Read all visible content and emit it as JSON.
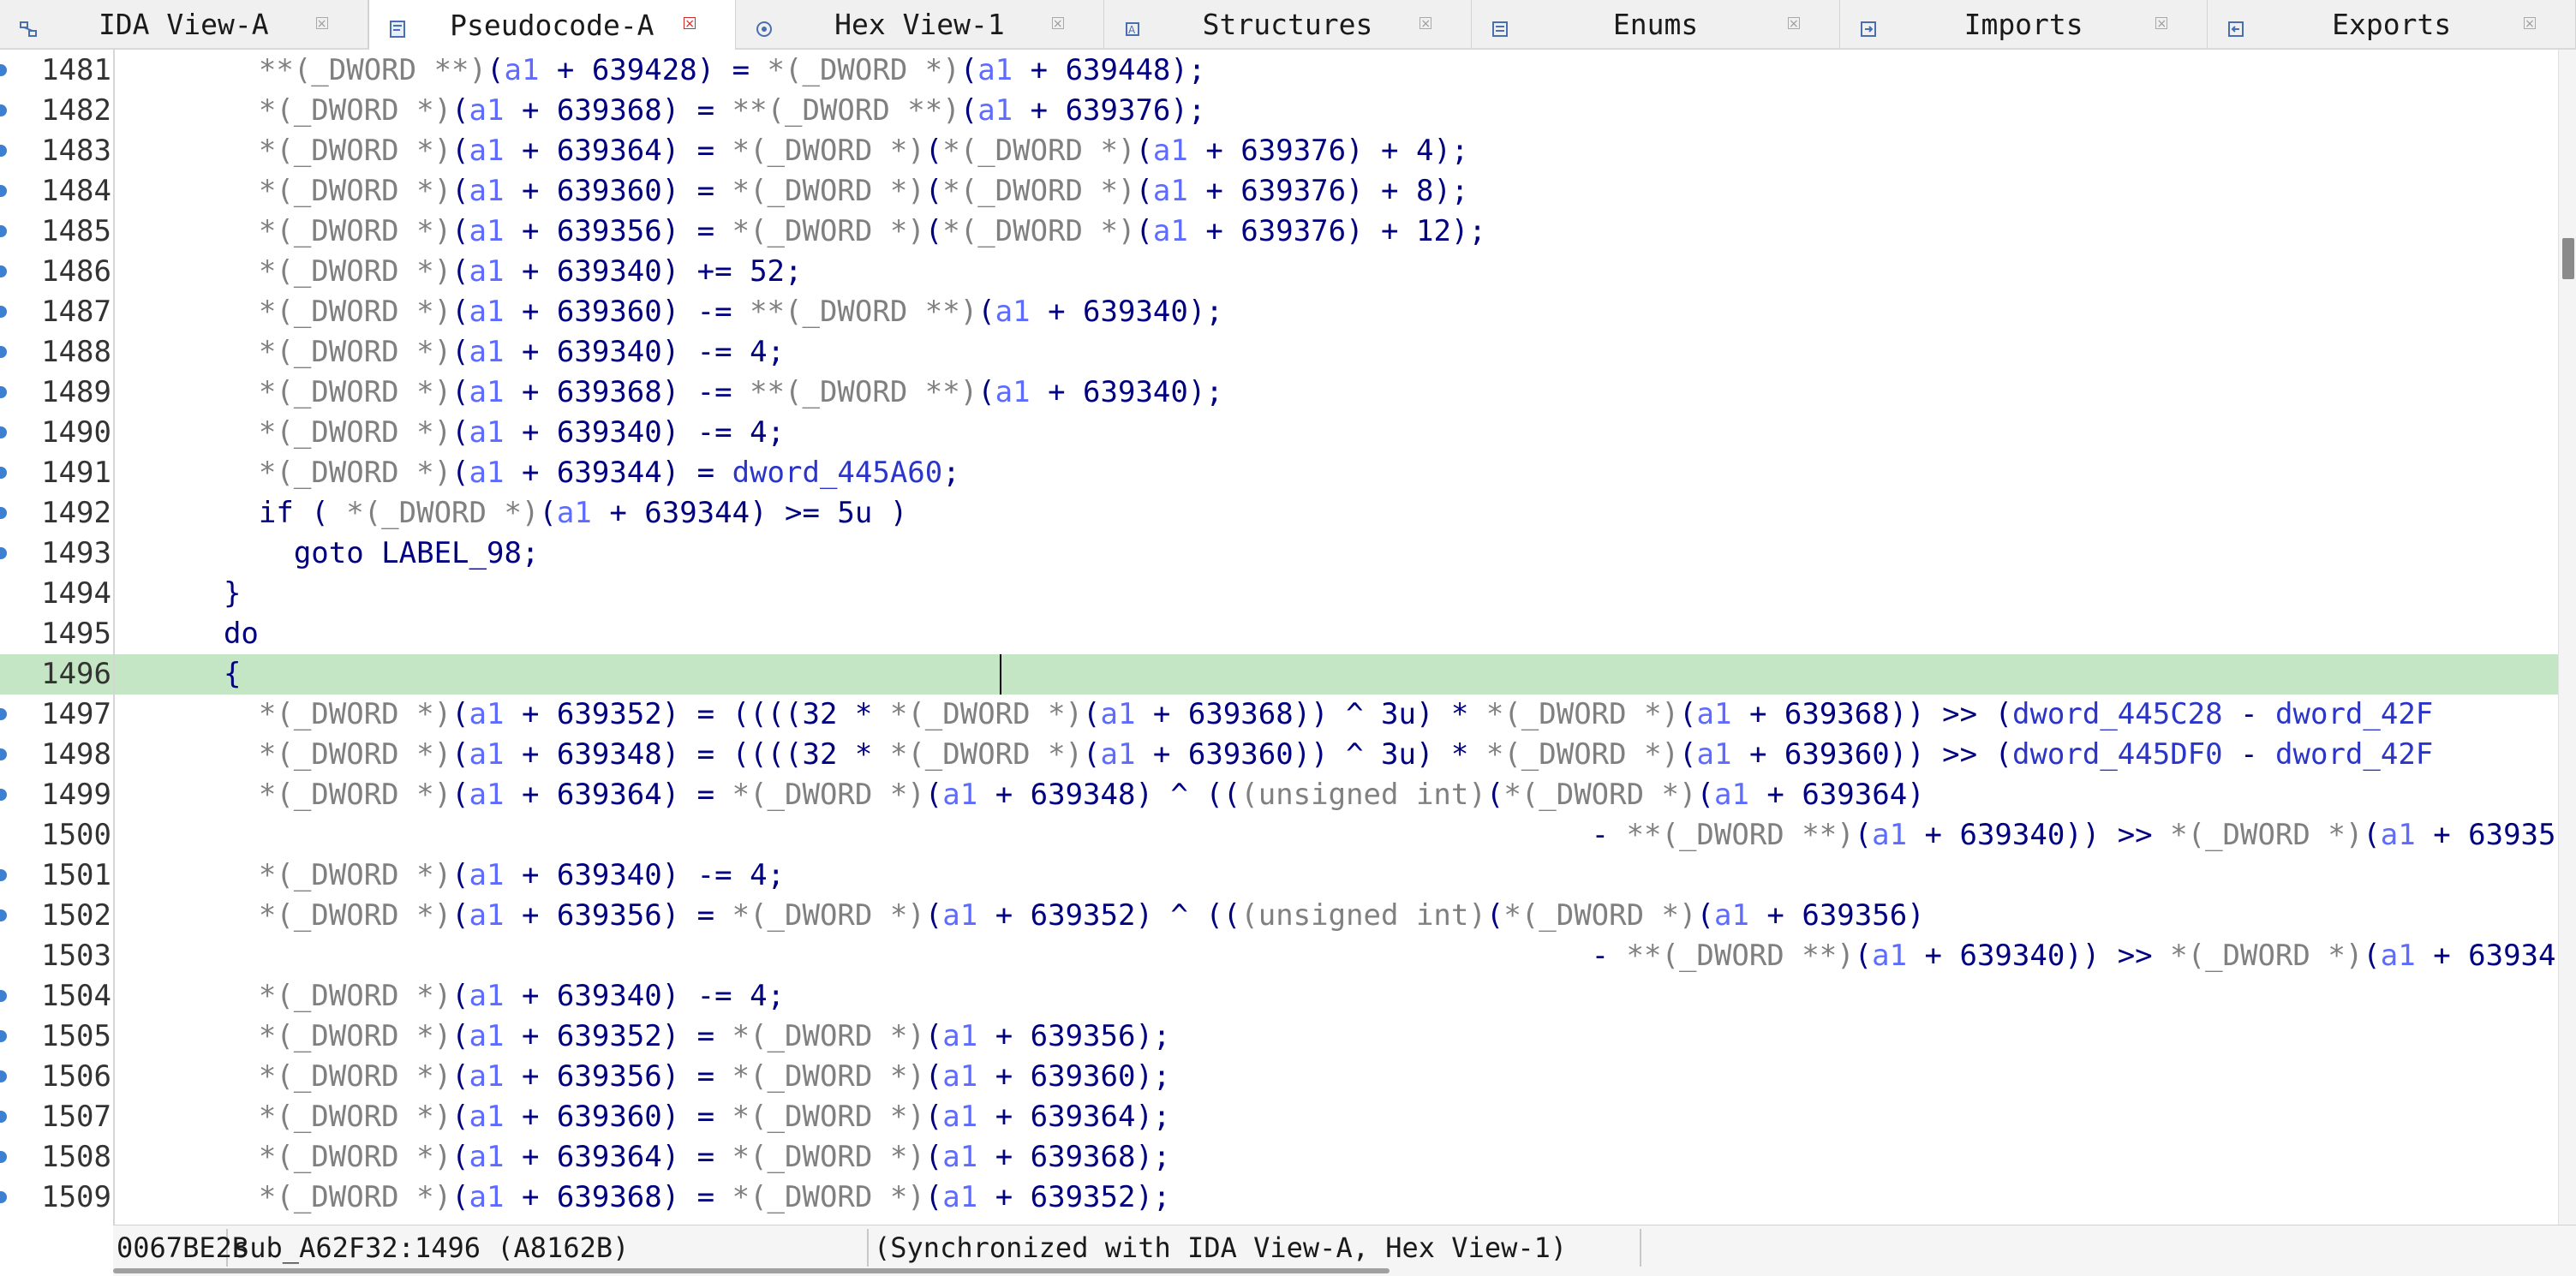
{
  "tabs": [
    {
      "id": "ida-view-a",
      "label": "IDA View-A",
      "active": false,
      "icon": "graph-view-icon"
    },
    {
      "id": "pseudocode-a",
      "label": "Pseudocode-A",
      "active": true,
      "icon": "pseudocode-icon"
    },
    {
      "id": "hex-view-1",
      "label": "Hex View-1",
      "active": false,
      "icon": "hex-icon"
    },
    {
      "id": "structures",
      "label": "Structures",
      "active": false,
      "icon": "structures-icon"
    },
    {
      "id": "enums",
      "label": "Enums",
      "active": false,
      "icon": "enums-icon"
    },
    {
      "id": "imports",
      "label": "Imports",
      "active": false,
      "icon": "imports-icon"
    },
    {
      "id": "exports",
      "label": "Exports",
      "active": false,
      "icon": "exports-icon"
    }
  ],
  "code": {
    "current_line": "1496",
    "lines": [
      {
        "n": "1481",
        "bp": true,
        "text": "    **(_DWORD **)(a1 + 639428) = *(_DWORD *)(a1 + 639448);"
      },
      {
        "n": "1482",
        "bp": true,
        "text": "    *(_DWORD *)(a1 + 639368) = **(_DWORD **)(a1 + 639376);"
      },
      {
        "n": "1483",
        "bp": true,
        "text": "    *(_DWORD *)(a1 + 639364) = *(_DWORD *)(*(_DWORD *)(a1 + 639376) + 4);"
      },
      {
        "n": "1484",
        "bp": true,
        "text": "    *(_DWORD *)(a1 + 639360) = *(_DWORD *)(*(_DWORD *)(a1 + 639376) + 8);"
      },
      {
        "n": "1485",
        "bp": true,
        "text": "    *(_DWORD *)(a1 + 639356) = *(_DWORD *)(*(_DWORD *)(a1 + 639376) + 12);"
      },
      {
        "n": "1486",
        "bp": true,
        "text": "    *(_DWORD *)(a1 + 639340) += 52;"
      },
      {
        "n": "1487",
        "bp": true,
        "text": "    *(_DWORD *)(a1 + 639360) -= **(_DWORD **)(a1 + 639340);"
      },
      {
        "n": "1488",
        "bp": true,
        "text": "    *(_DWORD *)(a1 + 639340) -= 4;"
      },
      {
        "n": "1489",
        "bp": true,
        "text": "    *(_DWORD *)(a1 + 639368) -= **(_DWORD **)(a1 + 639340);"
      },
      {
        "n": "1490",
        "bp": true,
        "text": "    *(_DWORD *)(a1 + 639340) -= 4;"
      },
      {
        "n": "1491",
        "bp": true,
        "text": "    *(_DWORD *)(a1 + 639344) = dword_445A60;"
      },
      {
        "n": "1492",
        "bp": true,
        "text": "    if ( *(_DWORD *)(a1 + 639344) >= 5u )"
      },
      {
        "n": "1493",
        "bp": true,
        "text": "      goto LABEL_98;"
      },
      {
        "n": "1494",
        "bp": false,
        "text": "  }"
      },
      {
        "n": "1495",
        "bp": false,
        "text": "  do"
      },
      {
        "n": "1496",
        "bp": false,
        "text": "  {"
      },
      {
        "n": "1497",
        "bp": true,
        "text": "    *(_DWORD *)(a1 + 639352) = ((((32 * *(_DWORD *)(a1 + 639368)) ^ 3u) * *(_DWORD *)(a1 + 639368)) >> (dword_445C28 - dword_42F"
      },
      {
        "n": "1498",
        "bp": true,
        "text": "    *(_DWORD *)(a1 + 639348) = ((((32 * *(_DWORD *)(a1 + 639360)) ^ 3u) * *(_DWORD *)(a1 + 639360)) >> (dword_445DF0 - dword_42F"
      },
      {
        "n": "1499",
        "bp": true,
        "text": "    *(_DWORD *)(a1 + 639364) = *(_DWORD *)(a1 + 639348) ^ (((unsigned int)(*(_DWORD *)(a1 + 639364)"
      },
      {
        "n": "1500",
        "bp": false,
        "text": "                                                                                - **(_DWORD **)(a1 + 639340)) >> *(_DWORD *)(a1 + 63935"
      },
      {
        "n": "1501",
        "bp": true,
        "text": "    *(_DWORD *)(a1 + 639340) -= 4;"
      },
      {
        "n": "1502",
        "bp": true,
        "text": "    *(_DWORD *)(a1 + 639356) = *(_DWORD *)(a1 + 639352) ^ (((unsigned int)(*(_DWORD *)(a1 + 639356)"
      },
      {
        "n": "1503",
        "bp": false,
        "text": "                                                                                - **(_DWORD **)(a1 + 639340)) >> *(_DWORD *)(a1 + 63934"
      },
      {
        "n": "1504",
        "bp": true,
        "text": "    *(_DWORD *)(a1 + 639340) -= 4;"
      },
      {
        "n": "1505",
        "bp": true,
        "text": "    *(_DWORD *)(a1 + 639352) = *(_DWORD *)(a1 + 639356);"
      },
      {
        "n": "1506",
        "bp": true,
        "text": "    *(_DWORD *)(a1 + 639356) = *(_DWORD *)(a1 + 639360);"
      },
      {
        "n": "1507",
        "bp": true,
        "text": "    *(_DWORD *)(a1 + 639360) = *(_DWORD *)(a1 + 639364);"
      },
      {
        "n": "1508",
        "bp": true,
        "text": "    *(_DWORD *)(a1 + 639364) = *(_DWORD *)(a1 + 639368);"
      },
      {
        "n": "1509",
        "bp": true,
        "text": "    *(_DWORD *)(a1 + 639368) = *(_DWORD *)(a1 + 639352);"
      }
    ],
    "colors": {
      "code_text": "#000080",
      "cast_type": "#808080",
      "local_var": "#5d6bff",
      "global_name": "#2b35c8",
      "highlight": "#c4e6c4",
      "breakpoint_marker": "#3d7fd1"
    }
  },
  "status": {
    "address": "0067BE2B",
    "location": "sub_A62F32:1496 (A8162B)",
    "sync": "(Synchronized with IDA View-A, Hex View-1)"
  }
}
